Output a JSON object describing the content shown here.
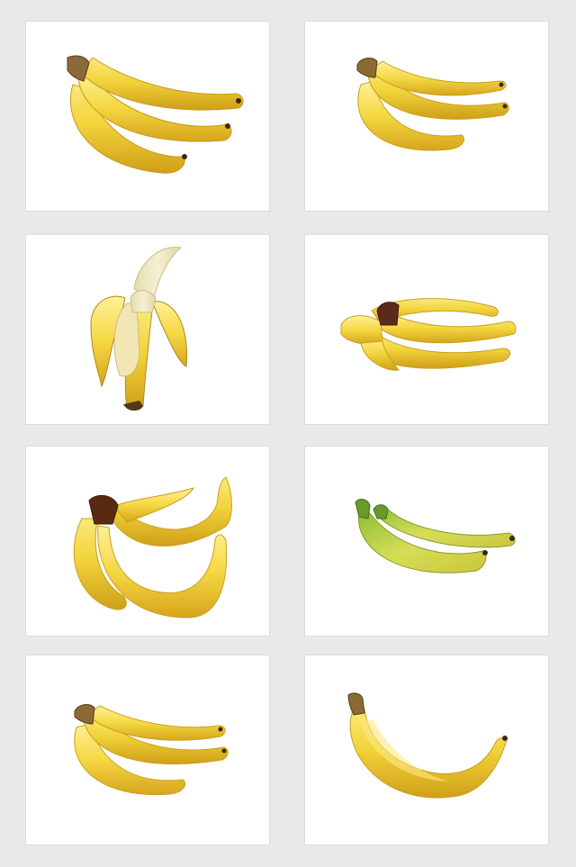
{
  "gallery": {
    "background_color": "#e9e9ea",
    "card_color": "#ffffff",
    "items": [
      {
        "subject": "banana-bunch-icon",
        "ripeness": "ripe"
      },
      {
        "subject": "banana-bunch-icon",
        "ripeness": "ripe"
      },
      {
        "subject": "peeled-banana-icon",
        "ripeness": "ripe"
      },
      {
        "subject": "banana-bunch-icon",
        "ripeness": "ripe"
      },
      {
        "subject": "banana-bunch-icon",
        "ripeness": "ripe"
      },
      {
        "subject": "green-banana-pair-icon",
        "ripeness": "unripe"
      },
      {
        "subject": "banana-bunch-icon",
        "ripeness": "ripe"
      },
      {
        "subject": "single-banana-icon",
        "ripeness": "ripe"
      }
    ]
  },
  "colors": {
    "banana_yellow": "#f2d33a",
    "banana_shadow": "#d9a81a",
    "banana_highlight": "#fbeb8a",
    "stem_brown": "#5a3a1a",
    "unripe_green": "#9cc04a",
    "flesh_cream": "#f3ecc6"
  }
}
